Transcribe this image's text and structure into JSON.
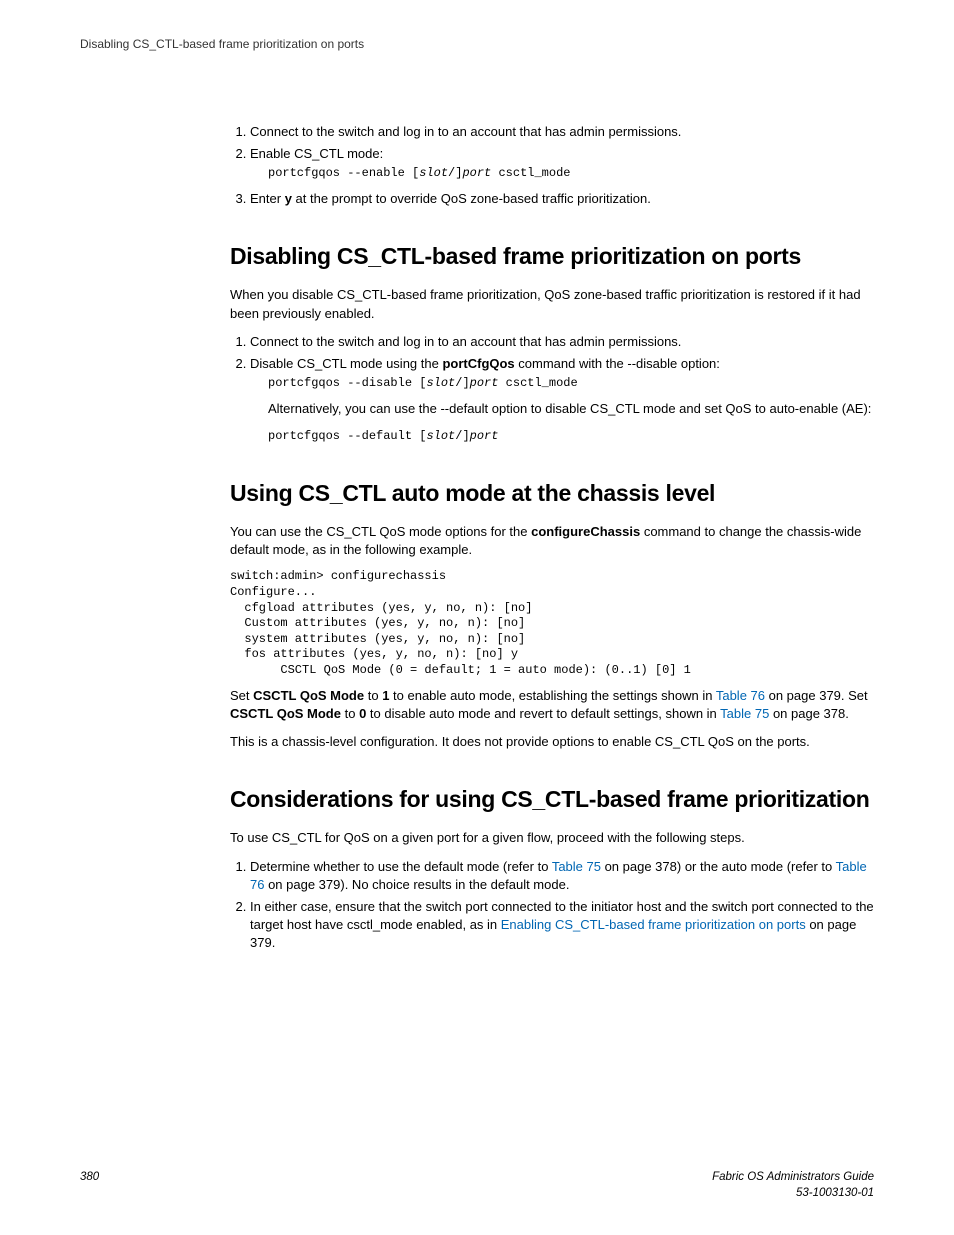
{
  "header": {
    "title": "Disabling CS_CTL-based frame prioritization on ports"
  },
  "intro_steps": {
    "s1": "Connect to the switch and log in to an account that has admin permissions.",
    "s2": "Enable CS_CTL mode:",
    "s2_cmd_a": "portcfgqos --enable [",
    "s2_cmd_slot": "slot",
    "s2_cmd_b": "/]",
    "s2_cmd_port": "port",
    "s2_cmd_c": " csctl_mode",
    "s3a": "Enter ",
    "s3b": "y",
    "s3c": " at the prompt to override QoS zone-based traffic prioritization."
  },
  "section1": {
    "heading": "Disabling CS_CTL-based frame prioritization on ports",
    "intro": "When you disable CS_CTL-based frame prioritization, QoS zone-based traffic prioritization is restored if it had been previously enabled.",
    "s1": "Connect to the switch and log in to an account that has admin permissions.",
    "s2a": "Disable CS_CTL mode using the ",
    "s2b": "portCfgQos",
    "s2c": " command with the --disable option:",
    "s2_cmd_a": "portcfgqos --disable [",
    "s2_cmd_slot": "slot",
    "s2_cmd_b": "/]",
    "s2_cmd_port": "port",
    "s2_cmd_c": " csctl_mode",
    "alt": "Alternatively, you can use the --default option to disable CS_CTL mode and set QoS to auto-enable (AE):",
    "alt_cmd_a": "portcfgqos --default [",
    "alt_cmd_slot": "slot",
    "alt_cmd_b": "/]",
    "alt_cmd_port": "port"
  },
  "section2": {
    "heading": "Using CS_CTL auto mode at the chassis level",
    "p1a": "You can use the CS_CTL QoS mode options for the ",
    "p1b": "configureChassis",
    "p1c": " command to change the chassis-wide default mode, as in the following example.",
    "code": "switch:admin> configurechassis\nConfigure...\n  cfgload attributes (yes, y, no, n): [no]\n  Custom attributes (yes, y, no, n): [no]\n  system attributes (yes, y, no, n): [no]\n  fos attributes (yes, y, no, n): [no] y\n       CSCTL QoS Mode (0 = default; 1 = auto mode): (0..1) [0] 1",
    "p2a": "Set ",
    "p2b": "CSCTL QoS Mode",
    "p2c": " to ",
    "p2d": "1",
    "p2e": " to enable auto mode, establishing the settings shown in ",
    "p2f": "Table 76",
    "p2g": " on page 379. Set ",
    "p2h": "CSCTL QoS Mode",
    "p2i": " to ",
    "p2j": "0",
    "p2k": " to disable auto mode and revert to default settings, shown in ",
    "p2l": "Table 75",
    "p2m": " on page 378.",
    "p3": "This is a chassis-level configuration. It does not provide options to enable CS_CTL QoS on the ports."
  },
  "section3": {
    "heading": "Considerations for using CS_CTL-based frame prioritization",
    "intro": "To use CS_CTL for QoS on a given port for a given flow, proceed with the following steps.",
    "s1a": "Determine whether to use the default mode (refer to ",
    "s1b": "Table 75",
    "s1c": " on page 378) or the auto mode (refer to ",
    "s1d": "Table 76",
    "s1e": " on page 379). No choice results in the default mode.",
    "s2a": "In either case, ensure that the switch port connected to the initiator host and the switch port connected to the target host have csctl_mode enabled, as in ",
    "s2b": "Enabling CS_CTL-based frame prioritization on ports",
    "s2c": " on page 379."
  },
  "footer": {
    "page": "380",
    "guide": "Fabric OS Administrators Guide",
    "docnum": "53-1003130-01"
  }
}
